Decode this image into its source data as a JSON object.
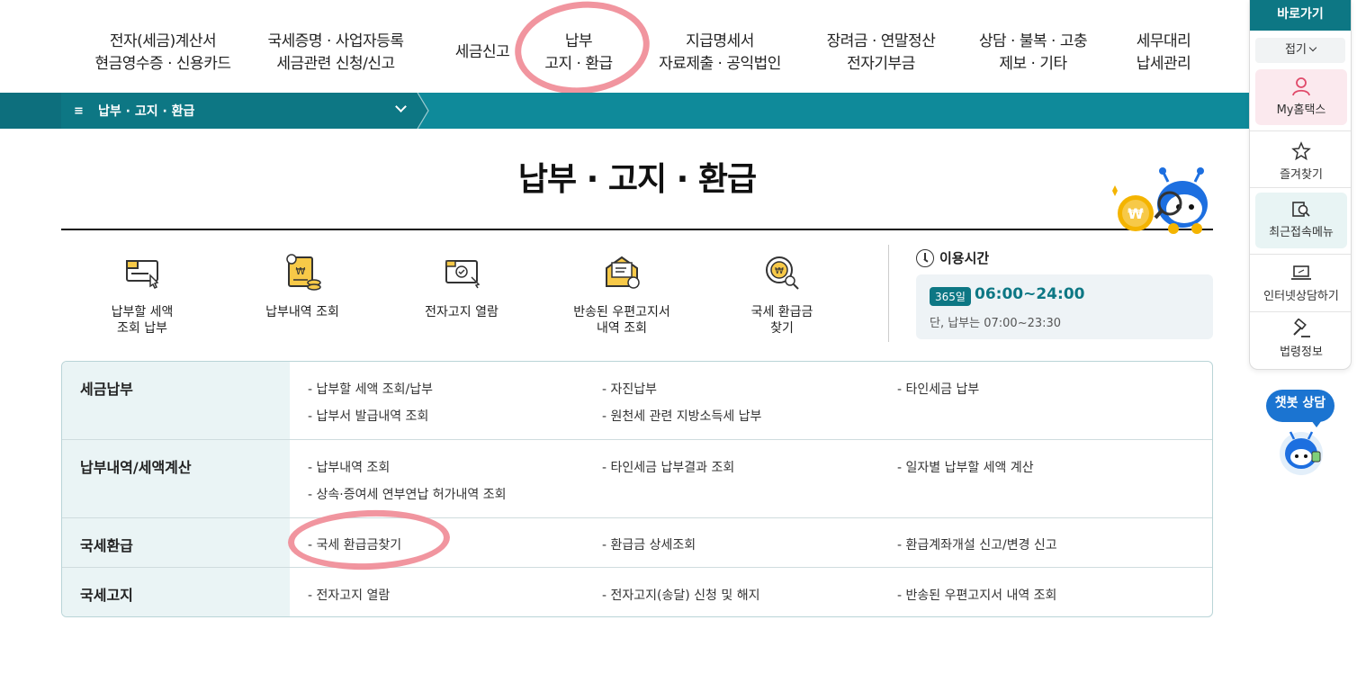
{
  "top_nav": [
    {
      "line1": "전자(세금)계산서",
      "line2": "현금영수증 · 신용카드"
    },
    {
      "line1": "국세증명 · 사업자등록",
      "line2": "세금관련 신청/신고"
    },
    {
      "line1": "세금신고",
      "line2": ""
    },
    {
      "line1": "납부",
      "line2": "고지 · 환급"
    },
    {
      "line1": "지급명세서",
      "line2": "자료제출 · 공익법인"
    },
    {
      "line1": "장려금 · 연말정산",
      "line2": "전자기부금"
    },
    {
      "line1": "상담 · 불복 · 고충",
      "line2": "제보 · 기타"
    },
    {
      "line1": "세무대리",
      "line2": "납세관리"
    }
  ],
  "breadcrumb": {
    "menu_icon": "≡",
    "label": "납부 · 고지 · 환급"
  },
  "page_title": "납부 · 고지 · 환급",
  "quick_links": [
    {
      "icon": "tax-payment-icon",
      "line1": "납부할 세액",
      "line2": "조회 납부"
    },
    {
      "icon": "payment-history-icon",
      "line1": "납부내역 조회",
      "line2": ""
    },
    {
      "icon": "e-notice-icon",
      "line1": "전자고지 열람",
      "line2": ""
    },
    {
      "icon": "returned-mail-icon",
      "line1": "반송된 우편고지서",
      "line2": "내역 조회"
    },
    {
      "icon": "refund-search-icon",
      "line1": "국세 환급금",
      "line2": "찾기"
    }
  ],
  "hours": {
    "title": "이용시간",
    "badge": "365일",
    "main": "06:00~24:00",
    "sub": "단, 납부는 07:00~23:30"
  },
  "table": [
    {
      "category": "세금납부",
      "links": [
        "- 납부할 세액 조회/납부",
        "- 자진납부",
        "- 타인세금 납부",
        "- 납부서 발급내역 조회",
        "- 원천세 관련 지방소득세 납부"
      ]
    },
    {
      "category": "납부내역/세액계산",
      "links": [
        "- 납부내역 조회",
        "- 타인세금 납부결과 조회",
        "- 일자별 납부할 세액 계산",
        "- 상속·증여세 연부연납 허가내역 조회"
      ]
    },
    {
      "category": "국세환급",
      "links": [
        "- 국세 환급금찾기",
        "- 환급금 상세조회",
        "- 환급계좌개설 신고/변경 신고"
      ]
    },
    {
      "category": "국세고지",
      "links": [
        "- 전자고지 열람",
        "- 전자고지(송달) 신청 및 해지",
        "- 반송된 우편고지서 내역 조회"
      ]
    }
  ],
  "sidebar": {
    "header": "바로가기",
    "fold": "접기",
    "items": [
      {
        "icon": "user-icon",
        "label": "My홈택스"
      },
      {
        "icon": "star-icon",
        "label": "즐겨찾기"
      },
      {
        "icon": "recent-menu-icon",
        "label": "최근접속메뉴"
      },
      {
        "icon": "laptop-icon",
        "label": "인터넷상담하기"
      },
      {
        "icon": "gavel-icon",
        "label": "법령정보"
      }
    ]
  },
  "chatbot": {
    "label": "챗봇 상담"
  },
  "colors": {
    "teal": "#0f8a9a",
    "teal_dark": "#0d7784",
    "highlight": "#ef8a95",
    "category_bg": "#eaf4f5"
  }
}
